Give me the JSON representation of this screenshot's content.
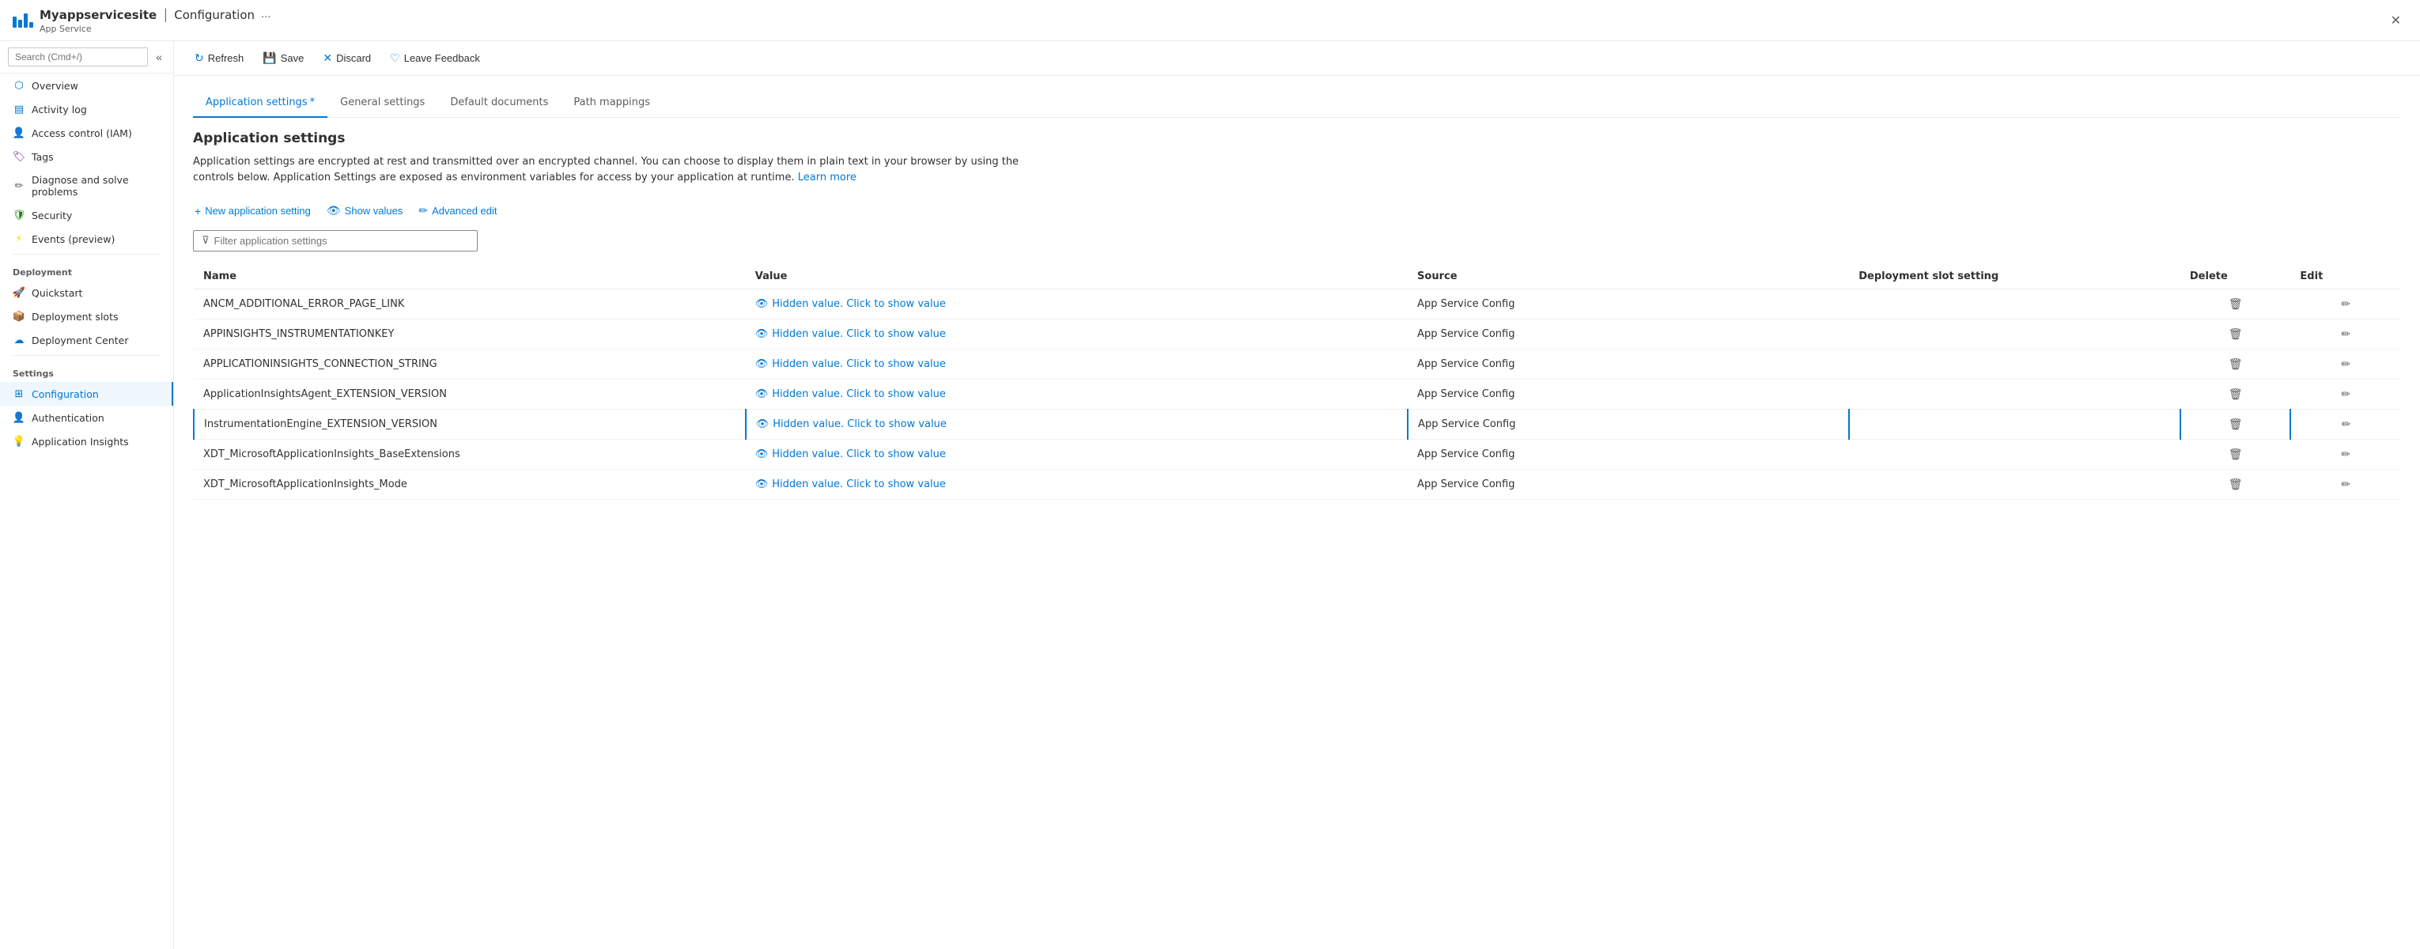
{
  "titlebar": {
    "app_name": "Myappservicesite",
    "divider": "|",
    "page_title": "Configuration",
    "subtitle": "App Service",
    "ellipsis": "...",
    "close_label": "✕"
  },
  "sidebar": {
    "search_placeholder": "Search (Cmd+/)",
    "items": [
      {
        "id": "overview",
        "label": "Overview",
        "icon": "⬡",
        "icon_class": "icon-circle-blue"
      },
      {
        "id": "activity-log",
        "label": "Activity log",
        "icon": "▤",
        "icon_class": "icon-blue"
      },
      {
        "id": "access-control",
        "label": "Access control (IAM)",
        "icon": "👤",
        "icon_class": "icon-blue"
      },
      {
        "id": "tags",
        "label": "Tags",
        "icon": "🏷",
        "icon_class": "icon-purple"
      },
      {
        "id": "diagnose",
        "label": "Diagnose and solve problems",
        "icon": "✏",
        "icon_class": "icon-pen"
      },
      {
        "id": "security",
        "label": "Security",
        "icon": "🛡",
        "icon_class": "icon-shield"
      },
      {
        "id": "events",
        "label": "Events (preview)",
        "icon": "⚡",
        "icon_class": "icon-yellow"
      }
    ],
    "deployment_section": "Deployment",
    "deployment_items": [
      {
        "id": "quickstart",
        "label": "Quickstart",
        "icon": "🚀",
        "icon_class": "icon-teal"
      },
      {
        "id": "deployment-slots",
        "label": "Deployment slots",
        "icon": "📦",
        "icon_class": "icon-orange"
      },
      {
        "id": "deployment-center",
        "label": "Deployment Center",
        "icon": "☁",
        "icon_class": "icon-blue"
      }
    ],
    "settings_section": "Settings",
    "settings_items": [
      {
        "id": "configuration",
        "label": "Configuration",
        "icon": "⚙",
        "icon_class": "icon-config",
        "active": true
      },
      {
        "id": "authentication",
        "label": "Authentication",
        "icon": "👤",
        "icon_class": "icon-person"
      },
      {
        "id": "application-insights",
        "label": "Application Insights",
        "icon": "💡",
        "icon_class": "icon-lightbulb"
      }
    ]
  },
  "toolbar": {
    "refresh_label": "Refresh",
    "save_label": "Save",
    "discard_label": "Discard",
    "feedback_label": "Leave Feedback"
  },
  "tabs": [
    {
      "id": "app-settings",
      "label": "Application settings",
      "active": true,
      "modified": true
    },
    {
      "id": "general-settings",
      "label": "General settings",
      "active": false
    },
    {
      "id": "default-documents",
      "label": "Default documents",
      "active": false
    },
    {
      "id": "path-mappings",
      "label": "Path mappings",
      "active": false
    }
  ],
  "page": {
    "section_title": "Application settings",
    "description": "Application settings are encrypted at rest and transmitted over an encrypted channel. You can choose to display them in plain text in your browser by using the controls below. Application Settings are exposed as environment variables for access by your application at runtime.",
    "learn_more_link": "Learn more",
    "new_setting_label": "New application setting",
    "show_values_label": "Show values",
    "advanced_edit_label": "Advanced edit",
    "filter_placeholder": "Filter application settings",
    "table_headers": [
      "Name",
      "Value",
      "Source",
      "Deployment slot setting",
      "Delete",
      "Edit"
    ],
    "settings_rows": [
      {
        "name": "ANCM_ADDITIONAL_ERROR_PAGE_LINK",
        "value": "Hidden value. Click to show value",
        "source": "App Service Config",
        "slot_setting": "",
        "selected": false
      },
      {
        "name": "APPINSIGHTS_INSTRUMENTATIONKEY",
        "value": "Hidden value. Click to show value",
        "source": "App Service Config",
        "slot_setting": "",
        "selected": false
      },
      {
        "name": "APPLICATIONINSIGHTS_CONNECTION_STRING",
        "value": "Hidden value. Click to show value",
        "source": "App Service Config",
        "slot_setting": "",
        "selected": false
      },
      {
        "name": "ApplicationInsightsAgent_EXTENSION_VERSION",
        "value": "Hidden value. Click to show value",
        "source": "App Service Config",
        "slot_setting": "",
        "selected": false
      },
      {
        "name": "InstrumentationEngine_EXTENSION_VERSION",
        "value": "Hidden value. Click to show value",
        "source": "App Service Config",
        "slot_setting": "",
        "selected": true
      },
      {
        "name": "XDT_MicrosoftApplicationInsights_BaseExtensions",
        "value": "Hidden value. Click to show value",
        "source": "App Service Config",
        "slot_setting": "",
        "selected": false
      },
      {
        "name": "XDT_MicrosoftApplicationInsights_Mode",
        "value": "Hidden value. Click to show value",
        "source": "App Service Config",
        "slot_setting": "",
        "selected": false
      }
    ]
  }
}
